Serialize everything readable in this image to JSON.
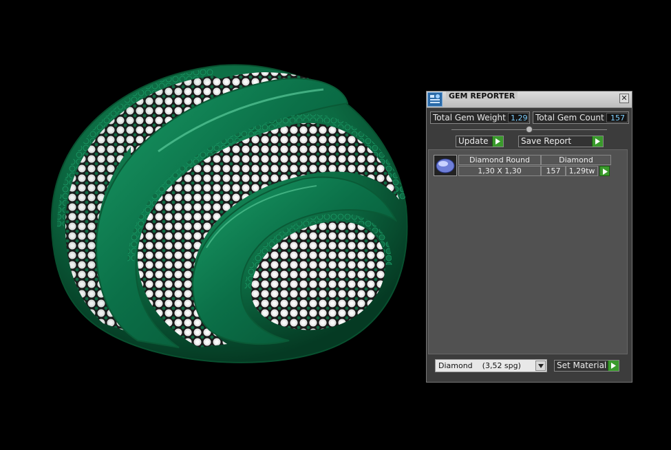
{
  "panel": {
    "title": "GEM REPORTER",
    "close_label": "✕",
    "total_weight_label": "Total Gem Weight",
    "total_weight_value": "1,29",
    "total_count_label": "Total Gem Count",
    "total_count_value": "157",
    "update_label": "Update",
    "save_report_label": "Save Report",
    "gems": [
      {
        "shape": "Diamond Round",
        "material": "Diamond",
        "size": "1,30 X 1,30",
        "count": "157",
        "weight": "1,29tw"
      }
    ],
    "material_select_value": "Diamond    (3,52 spg)",
    "set_material_label": "Set Material"
  },
  "colors": {
    "accent_green": "#3a9a2c",
    "model_green": "#0f6b44",
    "panel_bg": "#3c3c3c"
  },
  "icons": [
    "gem-reporter-icon",
    "close-icon",
    "play-arrow-icon",
    "round-diamond-icon",
    "chevron-down-icon"
  ]
}
